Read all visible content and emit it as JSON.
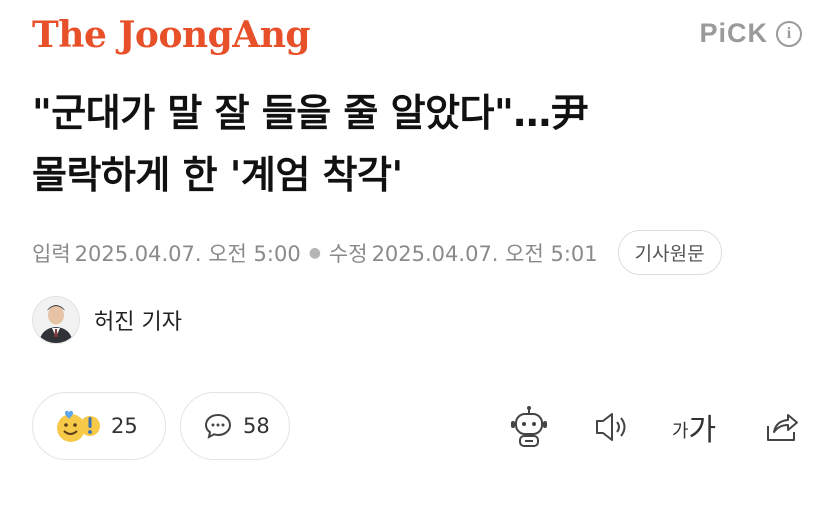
{
  "header": {
    "logo": "The JoongAng",
    "pick_label": "PiCK",
    "info_icon": "info-icon"
  },
  "article": {
    "title_line1": "\"군대가 말 잘 들을 줄 알았다\"…尹",
    "title_line2": "몰락하게 한 '계엄 착각'",
    "published_label": "입력",
    "published_time": "2025.04.07. 오전 5:00",
    "updated_label": "수정",
    "updated_time": "2025.04.07. 오전 5:01",
    "original_button": "기사원문",
    "reporter": "허진 기자"
  },
  "actions": {
    "reaction_count": "25",
    "comment_count": "58",
    "font_size_label_small": "가",
    "font_size_label_large": "가"
  },
  "colors": {
    "brand": "#e8502a",
    "muted": "#8a8a8a"
  }
}
